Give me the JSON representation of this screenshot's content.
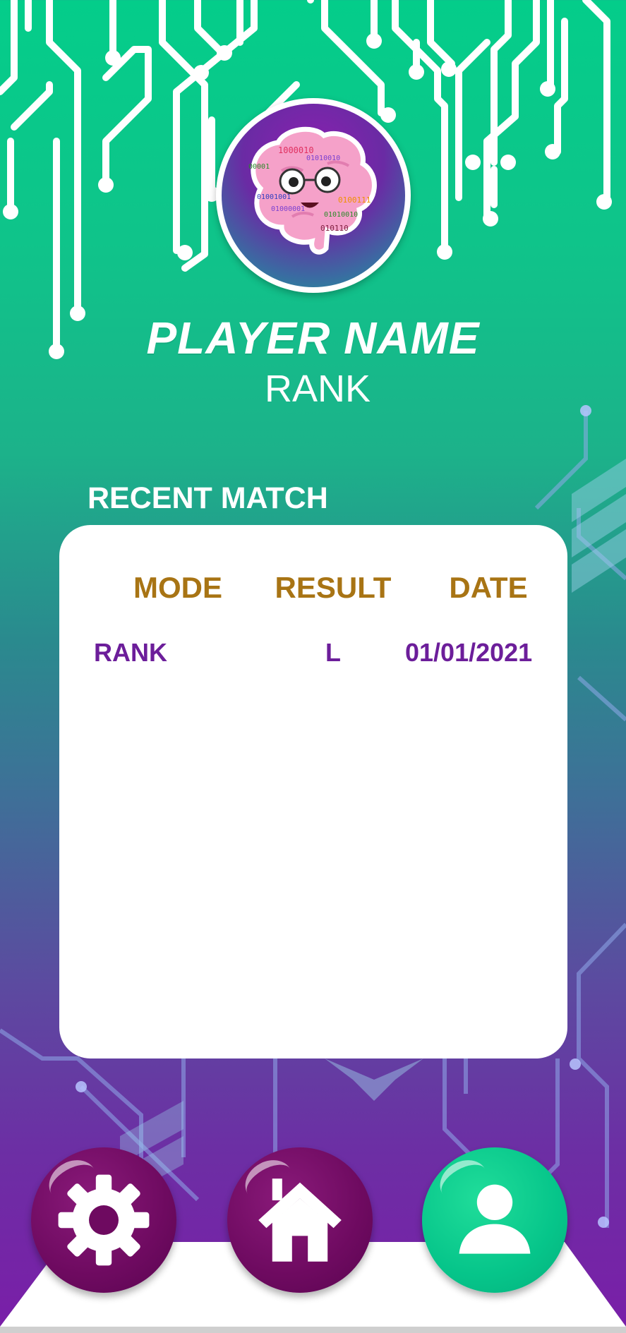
{
  "colors": {
    "bg_top": "#04cd8a",
    "bg_bottom": "#7a1ea8",
    "header_text": "#a87414",
    "row_text": "#6c1e9a",
    "nav_purple": "#6e0a60",
    "nav_active": "#06c58a"
  },
  "profile": {
    "player_name": "PLAYER NAME",
    "rank": "RANK",
    "avatar_icon": "brain-mascot-icon",
    "avatar_bits": [
      "1000010",
      "01010010",
      "00001",
      "01001001",
      "0100111",
      "01000001",
      "01010010",
      "010110"
    ]
  },
  "recent_match": {
    "title": "RECENT MATCH",
    "columns": [
      "MODE",
      "RESULT",
      "DATE"
    ],
    "rows": [
      {
        "mode": "RANK",
        "result": "L",
        "date": "01/01/2021"
      }
    ]
  },
  "nav": {
    "settings_icon": "gear-icon",
    "home_icon": "home-icon",
    "profile_icon": "user-icon",
    "active": "profile"
  }
}
